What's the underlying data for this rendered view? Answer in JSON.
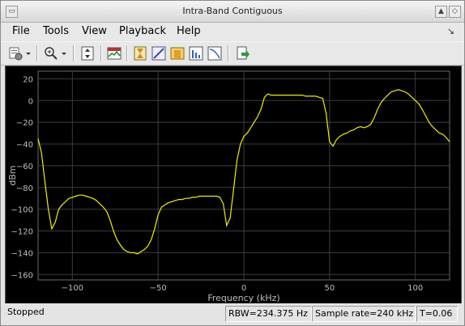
{
  "window": {
    "title": "Intra-Band Contiguous"
  },
  "menu": {
    "file": "File",
    "tools": "Tools",
    "view": "View",
    "playback": "Playback",
    "help": "Help"
  },
  "toolbar": {
    "icons": [
      "print-settings-icon",
      "dropdown-arrow-icon",
      "zoom-in-icon",
      "dropdown-arrow-icon",
      "autoscale-icon",
      "spectrum-settings-icon",
      "peak-finder-icon",
      "measurement-icon",
      "channel-measurement-icon",
      "distortion-icon",
      "ccdf-icon",
      "export-icon"
    ]
  },
  "status": {
    "state": "Stopped",
    "rbw": "RBW=234.375 Hz",
    "sample_rate": "Sample rate=240 kHz",
    "time": "T=0.06"
  },
  "colors": {
    "trace": "#f0f000",
    "background": "#000000",
    "grid": "#3c3c3c",
    "axis_text": "#bdbdbd"
  },
  "chart_data": {
    "type": "line",
    "title": "",
    "xlabel": "Frequency (kHz)",
    "ylabel": "dBm",
    "xlim": [
      -120,
      120
    ],
    "ylim": [
      -165,
      27
    ],
    "xticks": [
      -100,
      -50,
      0,
      50,
      100
    ],
    "yticks": [
      20,
      0,
      -20,
      -40,
      -60,
      -80,
      -100,
      -120,
      -140,
      -160
    ],
    "grid": true,
    "series": [
      {
        "x": [
          -120,
          -118,
          -116,
          -114,
          -112,
          -110,
          -108,
          -106,
          -104,
          -102,
          -100,
          -98,
          -96,
          -94,
          -92,
          -90,
          -88,
          -86,
          -84,
          -82,
          -80,
          -78,
          -76,
          -74,
          -72,
          -70,
          -68,
          -66,
          -64,
          -62,
          -60,
          -58,
          -56,
          -54,
          -52,
          -50,
          -48,
          -46,
          -44,
          -42,
          -40,
          -38,
          -36,
          -34,
          -32,
          -30,
          -28,
          -26,
          -24,
          -22,
          -20,
          -18,
          -16,
          -14,
          -12,
          -10,
          -8,
          -6,
          -4,
          -2,
          0,
          2,
          4,
          6,
          8,
          10,
          12,
          14,
          16,
          18,
          20,
          22,
          24,
          26,
          28,
          30,
          32,
          34,
          36,
          38,
          40,
          42,
          44,
          46,
          48,
          50,
          52,
          54,
          56,
          58,
          60,
          62,
          64,
          66,
          68,
          70,
          72,
          74,
          76,
          78,
          80,
          82,
          84,
          86,
          88,
          90,
          92,
          94,
          96,
          98,
          100,
          102,
          104,
          106,
          108,
          110,
          112,
          114,
          116,
          118,
          120
        ],
        "y": [
          -35,
          -48,
          -75,
          -100,
          -118,
          -112,
          -100,
          -96,
          -93,
          -90,
          -89,
          -88,
          -87,
          -87,
          -88,
          -89,
          -90,
          -92,
          -95,
          -98,
          -102,
          -110,
          -120,
          -128,
          -133,
          -137,
          -139,
          -140,
          -140,
          -141,
          -139,
          -137,
          -134,
          -128,
          -118,
          -105,
          -98,
          -96,
          -94,
          -93,
          -92,
          -91,
          -91,
          -90,
          -90,
          -89,
          -89,
          -88,
          -88,
          -88,
          -88,
          -88,
          -88,
          -89,
          -95,
          -115,
          -108,
          -82,
          -55,
          -40,
          -33,
          -30,
          -25,
          -20,
          -15,
          -8,
          3,
          6,
          5,
          5,
          5,
          5,
          5,
          5,
          5,
          5,
          5,
          5,
          4,
          4,
          4,
          4,
          3,
          2,
          -12,
          -38,
          -42,
          -36,
          -33,
          -31,
          -30,
          -28,
          -27,
          -25,
          -24,
          -25,
          -24,
          -22,
          -16,
          -8,
          -2,
          2,
          5,
          8,
          9,
          10,
          9,
          8,
          6,
          3,
          0,
          -3,
          -8,
          -14,
          -20,
          -24,
          -27,
          -30,
          -31,
          -34,
          -38
        ]
      }
    ]
  }
}
